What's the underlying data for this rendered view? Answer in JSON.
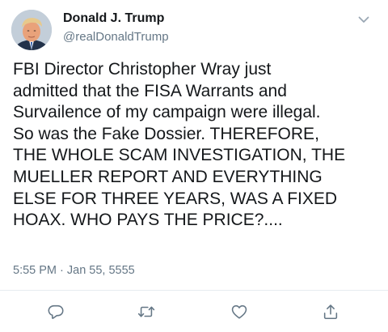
{
  "author": {
    "name": "Donald J. Trump",
    "handle": "@realDonaldTrump",
    "avatar_icon": "profile-photo"
  },
  "tweet": {
    "text": "FBI Director Christopher Wray just\nadmitted that the FISA Warrants and\nSurvailence of my campaign were illegal.\nSo was the Fake Dossier. THEREFORE,\nTHE WHOLE SCAM INVESTIGATION, THE\nMUELLER REPORT AND EVERYTHING\nELSE FOR THREE YEARS, WAS A FIXED\nHOAX. WHO PAYS THE PRICE?....",
    "timestamp": "5:55 PM · Jan 55, 5555"
  },
  "actions": [
    {
      "icon": "reply-icon"
    },
    {
      "icon": "retweet-icon"
    },
    {
      "icon": "like-icon"
    },
    {
      "icon": "share-icon"
    }
  ],
  "menu_icon": "chevron-down-icon",
  "colors": {
    "text": "#14171a",
    "secondary": "#657786",
    "icon": "#657786",
    "divider": "#e6ecf0"
  }
}
